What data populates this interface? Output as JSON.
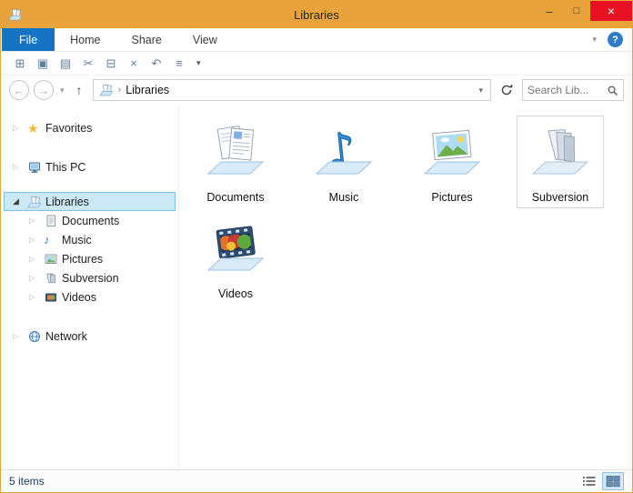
{
  "window": {
    "title": "Libraries",
    "controls": {
      "minimize_glyph": "–",
      "maximize_glyph": "□",
      "close_glyph": "×"
    }
  },
  "ribbon": {
    "file_tab": "File",
    "tabs": [
      {
        "label": "Home"
      },
      {
        "label": "Share"
      },
      {
        "label": "View"
      }
    ],
    "expand_chevron": "▾",
    "help_glyph": "?"
  },
  "quick_toolbar": {
    "buttons": [
      {
        "name": "new-window",
        "glyph": "⊞"
      },
      {
        "name": "copy",
        "glyph": "▣"
      },
      {
        "name": "paste",
        "glyph": "▤"
      },
      {
        "name": "cut",
        "glyph": "✂"
      },
      {
        "name": "copy-path",
        "glyph": "⊟"
      },
      {
        "name": "delete",
        "glyph": "×"
      },
      {
        "name": "undo",
        "glyph": "↶"
      },
      {
        "name": "properties",
        "glyph": "≡"
      }
    ],
    "customize_glyph": "▾"
  },
  "navigation": {
    "back_glyph": "←",
    "forward_glyph": "→",
    "history_dropdown_glyph": "▾",
    "up_glyph": "↑",
    "address": {
      "separator_glyph": "›",
      "location": "Libraries",
      "dropdown_glyph": "▾"
    },
    "search_placeholder": "Search Lib..."
  },
  "sidebar": {
    "collapsed_arrow": "▷",
    "expanded_arrow": "◢",
    "items": [
      {
        "label": "Favorites"
      },
      {
        "label": "This PC"
      },
      {
        "label": "Libraries"
      },
      {
        "label": "Documents"
      },
      {
        "label": "Music"
      },
      {
        "label": "Pictures"
      },
      {
        "label": "Subversion"
      },
      {
        "label": "Videos"
      },
      {
        "label": "Network"
      }
    ]
  },
  "content": {
    "items": [
      {
        "label": "Documents"
      },
      {
        "label": "Music"
      },
      {
        "label": "Pictures"
      },
      {
        "label": "Subversion"
      },
      {
        "label": "Videos"
      }
    ]
  },
  "status_bar": {
    "item_count": "5 items"
  },
  "colors": {
    "titlebar": "#E8A33C",
    "close_button": "#E81123",
    "file_tab": "#1574C4",
    "selection_bg": "#CBE8F6",
    "selection_border": "#7EC0E8"
  }
}
